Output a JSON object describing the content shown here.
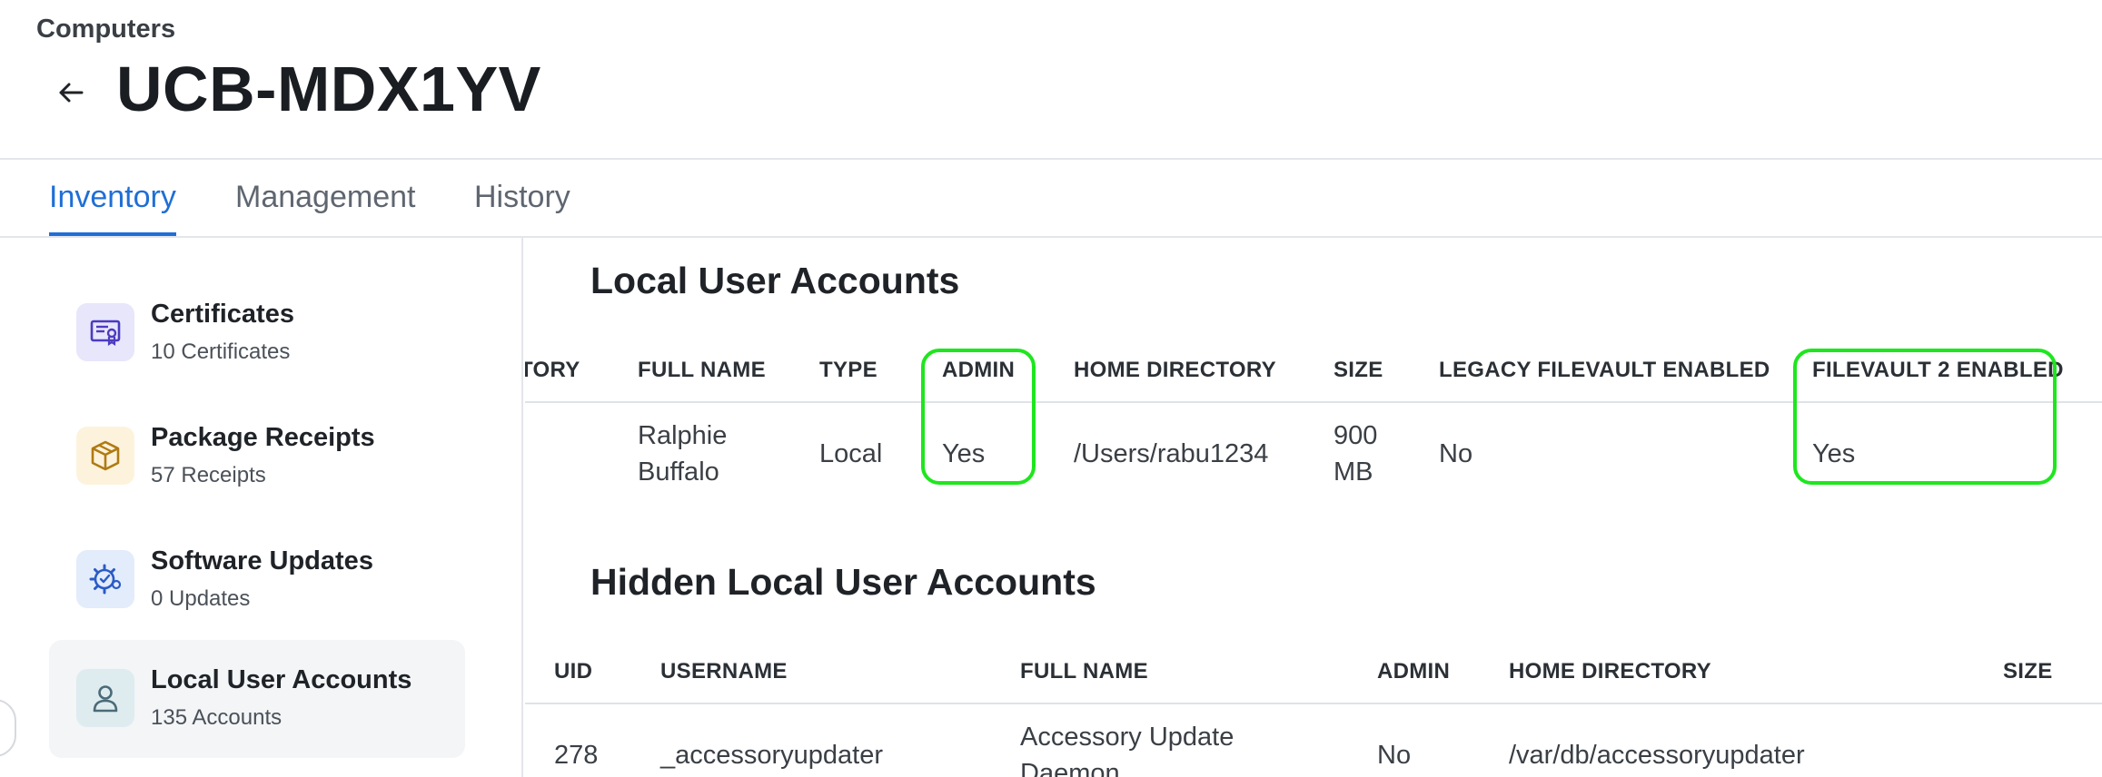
{
  "header": {
    "breadcrumb": "Computers",
    "title": "UCB-MDX1YV"
  },
  "tabs": [
    {
      "label": "Inventory",
      "active": true
    },
    {
      "label": "Management",
      "active": false
    },
    {
      "label": "History",
      "active": false
    }
  ],
  "sidebar": {
    "items": [
      {
        "title": "Certificates",
        "subtitle": "10 Certificates",
        "icon": "certificate-icon",
        "icon_bg": "#e7e6fb",
        "icon_color": "#4b3bbf"
      },
      {
        "title": "Package Receipts",
        "subtitle": "57 Receipts",
        "icon": "package-icon",
        "icon_bg": "#fdf3dc",
        "icon_color": "#b07a12"
      },
      {
        "title": "Software Updates",
        "subtitle": "0 Updates",
        "icon": "gear-update-icon",
        "icon_bg": "#e3ecfb",
        "icon_color": "#2a5bc7"
      },
      {
        "title": "Local User Accounts",
        "subtitle": "135 Accounts",
        "icon": "user-icon",
        "icon_bg": "#dfecef",
        "icon_color": "#4a6b78",
        "active": true
      }
    ]
  },
  "local_accounts": {
    "title": "Local User Accounts",
    "columns": [
      "TORY",
      "FULL NAME",
      "TYPE",
      "ADMIN",
      "HOME DIRECTORY",
      "SIZE",
      "LEGACY FILEVAULT ENABLED",
      "FILEVAULT 2 ENABLED"
    ],
    "row": {
      "full_name_line1": "Ralphie",
      "full_name_line2": "Buffalo",
      "type": "Local",
      "admin": "Yes",
      "home_directory": "/Users/rabu1234",
      "size_line1": "900",
      "size_line2": "MB",
      "legacy_filevault": "No",
      "filevault2": "Yes"
    }
  },
  "hidden_accounts": {
    "title": "Hidden Local User Accounts",
    "columns": [
      "UID",
      "USERNAME",
      "FULL NAME",
      "ADMIN",
      "HOME DIRECTORY",
      "SIZE"
    ],
    "row": {
      "uid": "278",
      "username": "_accessoryupdater",
      "full_name_line1": "Accessory Update",
      "full_name_line2": "Daemon",
      "admin": "No",
      "home_directory": "/var/db/accessoryupdater"
    }
  },
  "colors": {
    "accent": "#1f6fd6",
    "highlight": "#1ee61e"
  }
}
